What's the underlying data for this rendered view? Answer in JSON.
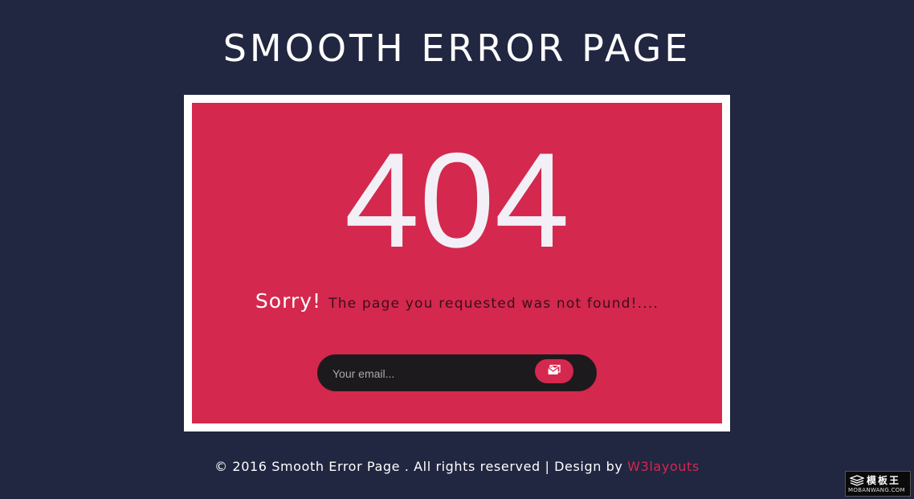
{
  "page": {
    "title": "SMOOTH ERROR PAGE"
  },
  "error": {
    "code": "404",
    "sorry": "Sorry!",
    "message": "The page you requested was not found!...."
  },
  "subscribe": {
    "placeholder": "Your email...",
    "button_icon": "mail-icon"
  },
  "footer": {
    "text": "© 2016 Smooth Error Page . All rights reserved | Design by",
    "link_label": "W3layouts"
  },
  "watermark": {
    "top": "模板王",
    "bottom": "MOBANWANG.COM"
  },
  "colors": {
    "background": "#212641",
    "accent": "#d4284e",
    "frame": "#ffffff",
    "input_bg": "#1c1a1c"
  }
}
